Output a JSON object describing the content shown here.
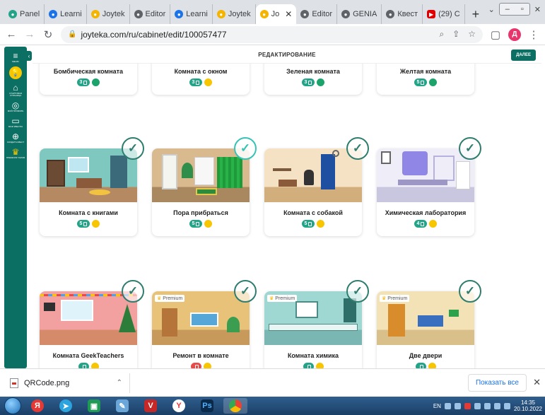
{
  "browser": {
    "tabs": [
      {
        "label": "Panel",
        "favicon_color": "#23a387"
      },
      {
        "label": "Learni",
        "favicon_color": "#1a73e8"
      },
      {
        "label": "Joytek",
        "favicon_color": "#f4b400"
      },
      {
        "label": "Editor",
        "favicon_color": "#5f6368"
      },
      {
        "label": "Learni",
        "favicon_color": "#1a73e8"
      },
      {
        "label": "Joytek",
        "favicon_color": "#f4b400"
      },
      {
        "label": "Jo",
        "favicon_color": "#f4b400",
        "active": true
      },
      {
        "label": "Editor",
        "favicon_color": "#5f6368"
      },
      {
        "label": "GENIA",
        "favicon_color": "#5f6368"
      },
      {
        "label": "Квест",
        "favicon_color": "#5f6368"
      },
      {
        "label": "(29) C",
        "favicon_color": "#e00000"
      }
    ],
    "url": "joyteka.com/ru/cabinet/edit/100057477",
    "profile_initial": "Д"
  },
  "sidebar": {
    "items": [
      {
        "label": "МЕНЮ"
      },
      {
        "label": "СТАРТОВАЯ СТРАНИЦА"
      },
      {
        "label": "МОЙ ПРОФИЛЬ"
      },
      {
        "label": "МОИ КВЕСТЫ"
      },
      {
        "label": "СОЗДАТЬ КВЕСТ"
      },
      {
        "label": "ПРЕМИУМ ТАРИФ"
      }
    ]
  },
  "header": {
    "title": "РЕДАКТИРОВАНИЕ",
    "next_label": "ДАЛЕЕ"
  },
  "rooms": [
    {
      "title": "Бомбическая комната",
      "count": "3",
      "dot": "#1aa36b",
      "selected": false,
      "premium": false
    },
    {
      "title": "Комната с окном",
      "count": "3",
      "dot": "#f7c600",
      "selected": false,
      "premium": false
    },
    {
      "title": "Зеленая комната",
      "count": "3",
      "dot": "#1aa36b",
      "selected": false,
      "premium": false
    },
    {
      "title": "Желтая комната",
      "count": "5",
      "dot": "#1aa36b",
      "selected": false,
      "premium": false
    },
    {
      "title": "Комната с книгами",
      "count": "5",
      "dot": "#f7c600",
      "selected": false,
      "premium": false
    },
    {
      "title": "Пора прибраться",
      "count": "5",
      "dot": "#f7c600",
      "selected": true,
      "premium": false
    },
    {
      "title": "Комната с собакой",
      "count": "5",
      "dot": "#f7c600",
      "selected": false,
      "premium": false
    },
    {
      "title": "Химическая лаборатория",
      "count": "4",
      "dot": "#f7c600",
      "selected": false,
      "premium": false
    },
    {
      "title": "Комната GeekTeachers",
      "count": "",
      "dot": "#f7c600",
      "selected": false,
      "premium": false
    },
    {
      "title": "Ремонт в комнате",
      "count": "",
      "dot": "#f7c600",
      "selected": false,
      "premium": true
    },
    {
      "title": "Комната химика",
      "count": "",
      "dot": "#f7c600",
      "selected": false,
      "premium": true
    },
    {
      "title": "Две двери",
      "count": "",
      "dot": "#f7c600",
      "selected": false,
      "premium": true
    }
  ],
  "premium_label": "Premium",
  "downloads": {
    "file_name": "QRCode.png",
    "show_all": "Показать все"
  },
  "taskbar": {
    "lang": "EN",
    "time": "14:35",
    "date": "20.10.2022"
  }
}
